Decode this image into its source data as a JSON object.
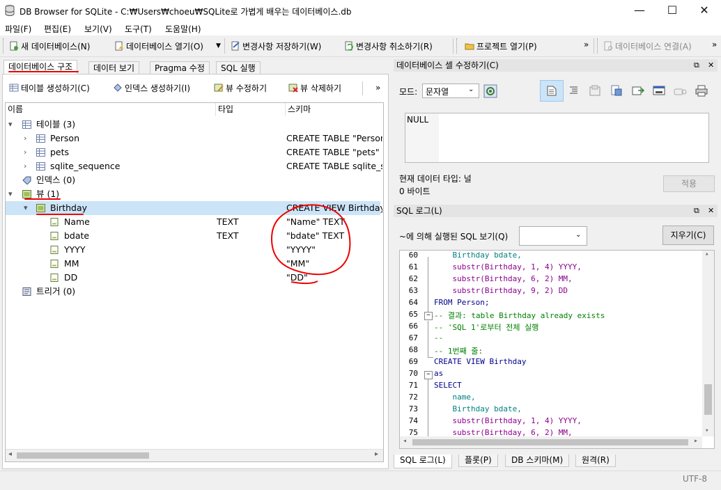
{
  "window": {
    "title": "DB Browser for SQLite - C:₩Users₩choeu₩SQLite로 가볍게 배우는 데이터베이스.db",
    "minimize": "—",
    "maximize": "☐",
    "close": "✕"
  },
  "menu": [
    "파일(F)",
    "편집(E)",
    "보기(V)",
    "도구(T)",
    "도움말(H)"
  ],
  "toolbar": {
    "new_db": "새 데이터베이스(N)",
    "open_db": "데이터베이스 열기(O)",
    "write_changes": "변경사항 저장하기(W)",
    "revert_changes": "변경사항 취소하기(R)",
    "open_project": "프로젝트 열기(P)",
    "attach_db": "데이터베이스 연결(A)",
    "more": "»"
  },
  "main_tabs": [
    "데이터베이스 구조",
    "데이터 보기",
    "Pragma 수정",
    "SQL 실행"
  ],
  "structure_toolbar": {
    "create_table": "테이블 생성하기(C)",
    "create_index": "인덱스 생성하기(I)",
    "modify_view": "뷰 수정하기",
    "delete_view": "뷰 삭제하기",
    "more": "»"
  },
  "tree": {
    "columns": [
      "이름",
      "타입",
      "스키마"
    ],
    "tables_label": "테이블 (3)",
    "tables": [
      {
        "name": "Person",
        "schema": "CREATE TABLE \"Person\" ("
      },
      {
        "name": "pets",
        "schema": "CREATE TABLE \"pets\" ("
      },
      {
        "name": "sqlite_sequence",
        "schema": "CREATE TABLE sqlite_sequence"
      }
    ],
    "indices_label": "인덱스 (0)",
    "views_label": "뷰 (1)",
    "view": {
      "name": "Birthday",
      "schema": "CREATE VIEW Birthday"
    },
    "view_fields": [
      {
        "name": "Name",
        "type": "TEXT",
        "schema": "\"Name\" TEXT"
      },
      {
        "name": "bdate",
        "type": "TEXT",
        "schema": "\"bdate\" TEXT"
      },
      {
        "name": "YYYY",
        "type": "",
        "schema": "\"YYYY\""
      },
      {
        "name": "MM",
        "type": "",
        "schema": "\"MM\""
      },
      {
        "name": "DD",
        "type": "",
        "schema": "\"DD\""
      }
    ],
    "triggers_label": "트리거 (0)"
  },
  "edit_cell": {
    "title": "데이터베이스 셀 수정하기(C)",
    "mode_label": "모드:",
    "mode_value": "문자열",
    "value": "NULL",
    "type_text": "현재 데이터 타입: 널",
    "size_text": "0 바이트",
    "apply": "적용"
  },
  "sql_log": {
    "title": "SQL 로그(L)",
    "submitted_by_label": "~에 의해 실행된 SQL 보기(Q)",
    "clear": "지우기(C)",
    "lines": [
      {
        "n": "60",
        "text": "    Birthday bdate,"
      },
      {
        "n": "61",
        "text": "    substr(Birthday, 1, 4) YYYY,"
      },
      {
        "n": "62",
        "text": "    substr(Birthday, 6, 2) MM,"
      },
      {
        "n": "63",
        "text": "    substr(Birthday, 9, 2) DD"
      },
      {
        "n": "64",
        "text": "FROM Person;"
      },
      {
        "n": "65",
        "text": "-- 결과: table Birthday already exists"
      },
      {
        "n": "66",
        "text": "-- 'SQL 1'로부터 전체 실행"
      },
      {
        "n": "67",
        "text": "--"
      },
      {
        "n": "68",
        "text": "-- 1번째 줄:"
      },
      {
        "n": "69",
        "text": "CREATE VIEW Birthday"
      },
      {
        "n": "70",
        "text": "as"
      },
      {
        "n": "71",
        "text": "SELECT"
      },
      {
        "n": "72",
        "text": "    name,"
      },
      {
        "n": "73",
        "text": "    Birthday bdate,"
      },
      {
        "n": "74",
        "text": "    substr(Birthday, 1, 4) YYYY,"
      },
      {
        "n": "75",
        "text": "    substr(Birthday, 6, 2) MM,"
      }
    ]
  },
  "bottom_tabs": [
    "SQL 로그(L)",
    "플롯(P)",
    "DB 스키마(M)",
    "원격(R)"
  ],
  "status": {
    "encoding": "UTF-8"
  },
  "colors": {
    "accent": "#0078d7",
    "selection": "#cce4f7",
    "annotation": "#e00000"
  }
}
